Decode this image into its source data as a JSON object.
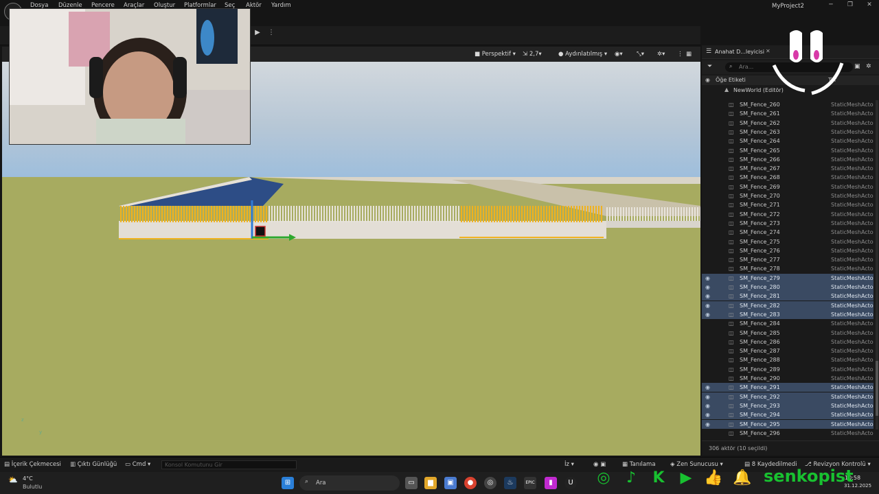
{
  "menu": {
    "logo_icon": "unreal-logo-icon",
    "items": [
      "Dosya",
      "Düzenle",
      "Pencere",
      "Araçlar",
      "Oluştur",
      "Platformlar",
      "Seç",
      "Aktör",
      "Yardım"
    ],
    "window_title": "MyProject2",
    "minimize": "─",
    "maximize": "❐",
    "close": "✕"
  },
  "toolbar": {
    "play": "▶",
    "more": "⋮"
  },
  "viewport": {
    "perspective": "Perspektif",
    "fov": "2,7",
    "lighting": "Aydınlatılmış",
    "axis_z": "z",
    "axis_y": "y"
  },
  "outliner": {
    "tab_label": "Anahat D...leyicisi",
    "tab_close": "✕",
    "search_placeholder": "Ara...",
    "column_label": "Öğe Etiketi",
    "column_type": "Tür",
    "world_label": "NewWorld (Editör)",
    "rows": [
      {
        "name": "SM_Fence_260",
        "type": "StaticMeshActo",
        "sel": false
      },
      {
        "name": "SM_Fence_261",
        "type": "StaticMeshActo",
        "sel": false
      },
      {
        "name": "SM_Fence_262",
        "type": "StaticMeshActo",
        "sel": false
      },
      {
        "name": "SM_Fence_263",
        "type": "StaticMeshActo",
        "sel": false
      },
      {
        "name": "SM_Fence_264",
        "type": "StaticMeshActo",
        "sel": false
      },
      {
        "name": "SM_Fence_265",
        "type": "StaticMeshActo",
        "sel": false
      },
      {
        "name": "SM_Fence_266",
        "type": "StaticMeshActo",
        "sel": false
      },
      {
        "name": "SM_Fence_267",
        "type": "StaticMeshActo",
        "sel": false
      },
      {
        "name": "SM_Fence_268",
        "type": "StaticMeshActo",
        "sel": false
      },
      {
        "name": "SM_Fence_269",
        "type": "StaticMeshActo",
        "sel": false
      },
      {
        "name": "SM_Fence_270",
        "type": "StaticMeshActo",
        "sel": false
      },
      {
        "name": "SM_Fence_271",
        "type": "StaticMeshActo",
        "sel": false
      },
      {
        "name": "SM_Fence_272",
        "type": "StaticMeshActo",
        "sel": false
      },
      {
        "name": "SM_Fence_273",
        "type": "StaticMeshActo",
        "sel": false
      },
      {
        "name": "SM_Fence_274",
        "type": "StaticMeshActo",
        "sel": false
      },
      {
        "name": "SM_Fence_275",
        "type": "StaticMeshActo",
        "sel": false
      },
      {
        "name": "SM_Fence_276",
        "type": "StaticMeshActo",
        "sel": false
      },
      {
        "name": "SM_Fence_277",
        "type": "StaticMeshActo",
        "sel": false
      },
      {
        "name": "SM_Fence_278",
        "type": "StaticMeshActo",
        "sel": false
      },
      {
        "name": "SM_Fence_279",
        "type": "StaticMeshActo",
        "sel": true
      },
      {
        "name": "SM_Fence_280",
        "type": "StaticMeshActo",
        "sel": true
      },
      {
        "name": "SM_Fence_281",
        "type": "StaticMeshActo",
        "sel": true
      },
      {
        "name": "SM_Fence_282",
        "type": "StaticMeshActo",
        "sel": true
      },
      {
        "name": "SM_Fence_283",
        "type": "StaticMeshActo",
        "sel": true
      },
      {
        "name": "SM_Fence_284",
        "type": "StaticMeshActo",
        "sel": false
      },
      {
        "name": "SM_Fence_285",
        "type": "StaticMeshActo",
        "sel": false
      },
      {
        "name": "SM_Fence_286",
        "type": "StaticMeshActo",
        "sel": false
      },
      {
        "name": "SM_Fence_287",
        "type": "StaticMeshActo",
        "sel": false
      },
      {
        "name": "SM_Fence_288",
        "type": "StaticMeshActo",
        "sel": false
      },
      {
        "name": "SM_Fence_289",
        "type": "StaticMeshActo",
        "sel": false
      },
      {
        "name": "SM_Fence_290",
        "type": "StaticMeshActo",
        "sel": false
      },
      {
        "name": "SM_Fence_291",
        "type": "StaticMeshActo",
        "sel": true
      },
      {
        "name": "SM_Fence_292",
        "type": "StaticMeshActo",
        "sel": true
      },
      {
        "name": "SM_Fence_293",
        "type": "StaticMeshActo",
        "sel": true
      },
      {
        "name": "SM_Fence_294",
        "type": "StaticMeshActo",
        "sel": true
      },
      {
        "name": "SM_Fence_295",
        "type": "StaticMeshActo",
        "sel": true
      },
      {
        "name": "SM_Fence_296",
        "type": "StaticMeshActo",
        "sel": false
      }
    ],
    "status": "306 aktör (10 seçildi)"
  },
  "bottombar": {
    "content_drawer": "İçerik Çekmecesi",
    "output_log": "Çıktı Günlüğü",
    "cmd": "Cmd",
    "console_placeholder": "Konsol Komutunu Gir",
    "trace": "İz",
    "derive": "Tanılama",
    "zen": "Zen Sunucusu",
    "unsaved": "8 Kaydedilmedi",
    "revision": "Revizyon Kontrolü"
  },
  "taskbar": {
    "weather_temp": "4°C",
    "weather_desc": "Bulutlu",
    "search_placeholder": "Ara",
    "time": "10:58",
    "date": "31.12.2025"
  },
  "overlay": {
    "brand_name": "senkopist"
  },
  "colors": {
    "selection": "#3a4a62",
    "grass": "#a7ab60",
    "fence_selected": "#f0b21e",
    "social_green": "#18c130"
  }
}
